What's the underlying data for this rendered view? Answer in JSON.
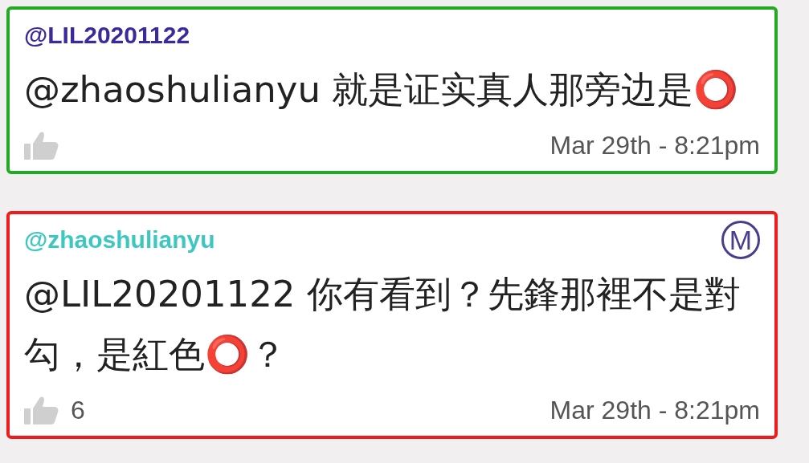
{
  "comments": [
    {
      "username": {
        "text": "@LIL20201122",
        "color": "#3d2a9a"
      },
      "color": "#22aa22",
      "text": "@zhaoshulianyu 就是证实真人那旁边是⭕",
      "time": "Mar 29th - 8:21pm"
    },
    {
      "username": {
        "text": "@zhaoshulianyu",
        "color": "#3cc8c0"
      },
      "color": "#ee1c1c",
      "badge": "M",
      "text": "@LIL20201122 你有看到？先鋒那裡不是對勾，是紅色⭕？",
      "likes": "6",
      "time": "Mar 29th - 8:21pm"
    }
  ]
}
